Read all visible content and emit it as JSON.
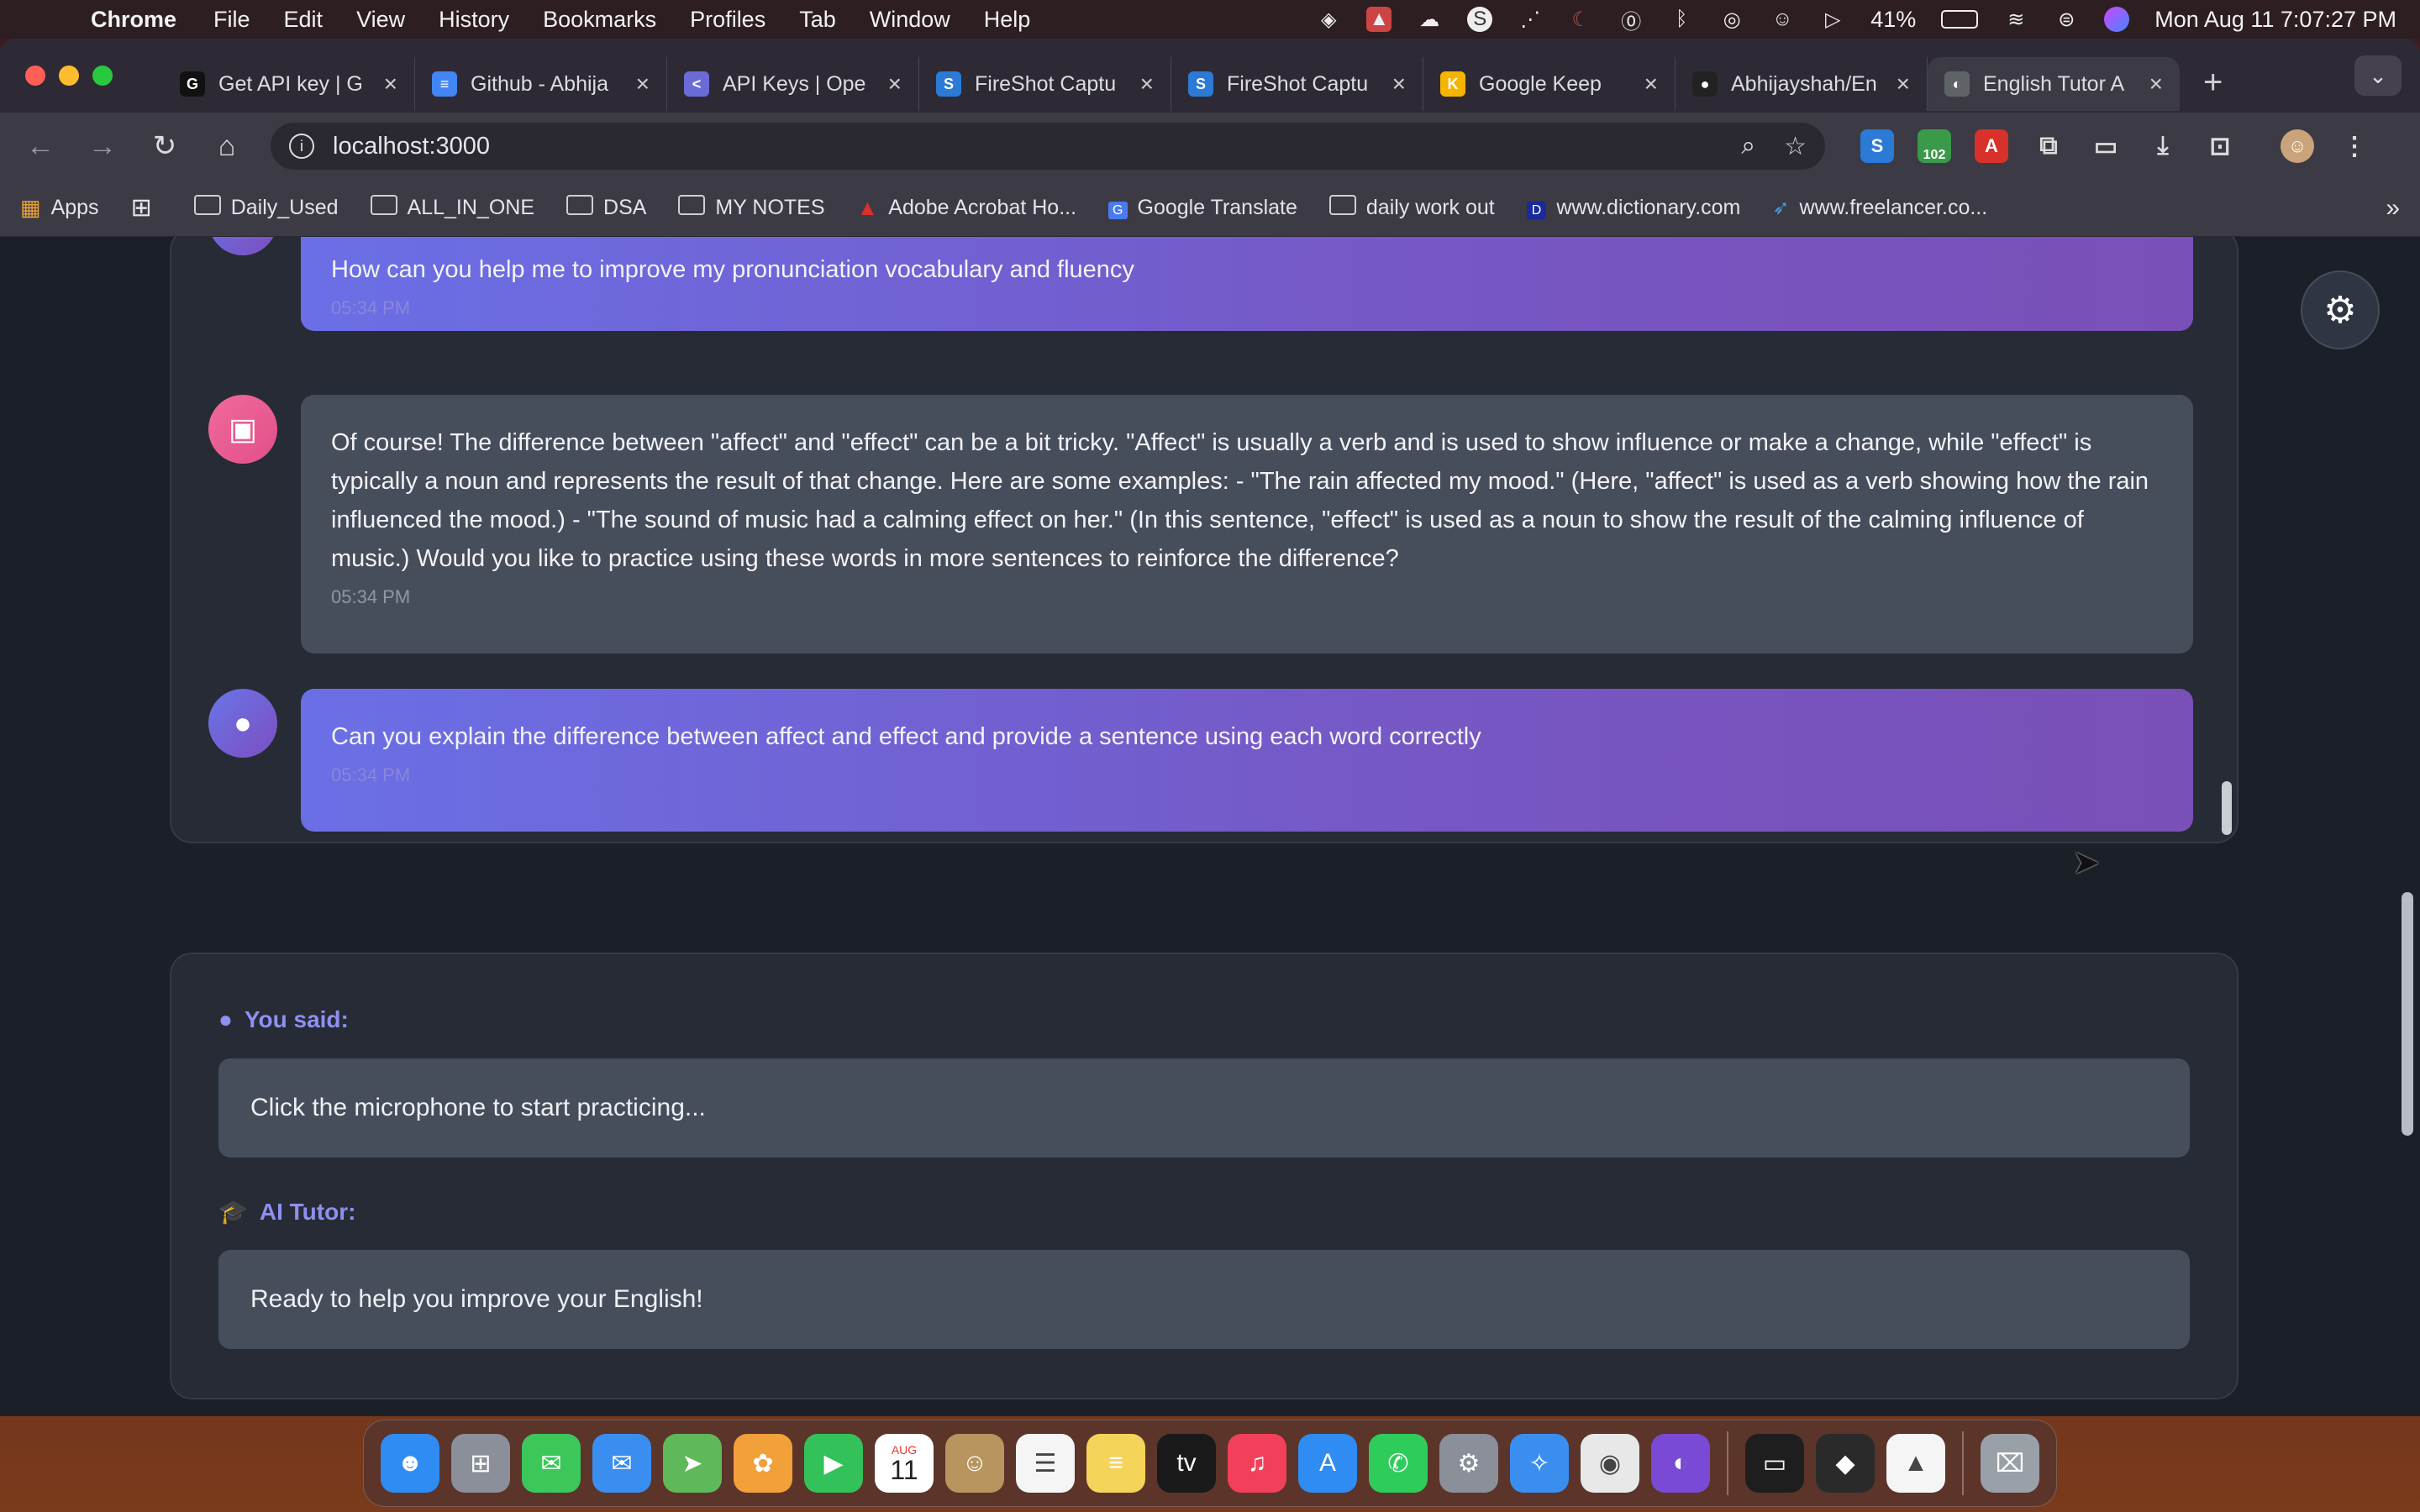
{
  "menubar": {
    "app": "Chrome",
    "items": [
      "File",
      "Edit",
      "View",
      "History",
      "Bookmarks",
      "Profiles",
      "Tab",
      "Window",
      "Help"
    ],
    "battery": "41%",
    "datetime": "Mon Aug 11  7:07:27 PM"
  },
  "tabs": [
    {
      "title": "Get API key | G",
      "color": "#111111",
      "glyph": "G"
    },
    {
      "title": "Github - Abhija",
      "color": "#4285f4",
      "glyph": "≡"
    },
    {
      "title": "API Keys | Ope",
      "color": "#6b6bd8",
      "glyph": "<"
    },
    {
      "title": "FireShot Captu",
      "color": "#2a7ad6",
      "glyph": "S"
    },
    {
      "title": "FireShot Captu",
      "color": "#2a7ad6",
      "glyph": "S"
    },
    {
      "title": "Google Keep",
      "color": "#f6b400",
      "glyph": "K"
    },
    {
      "title": "Abhijayshah/En",
      "color": "#222222",
      "glyph": "●"
    },
    {
      "title": "English Tutor A",
      "color": "#5f6368",
      "glyph": "◐"
    }
  ],
  "address": {
    "url": "localhost:3000"
  },
  "extensions": {
    "badge": "102"
  },
  "bookmarks": [
    {
      "label": "Apps",
      "type": "apps"
    },
    {
      "label": "",
      "type": "grid"
    },
    {
      "label": "Daily_Used",
      "type": "folder"
    },
    {
      "label": "ALL_IN_ONE",
      "type": "folder"
    },
    {
      "label": "DSA",
      "type": "folder"
    },
    {
      "label": "MY NOTES",
      "type": "folder"
    },
    {
      "label": "Adobe Acrobat Ho...",
      "type": "acrobat"
    },
    {
      "label": "Google Translate",
      "type": "translate"
    },
    {
      "label": "daily work out",
      "type": "folder"
    },
    {
      "label": "www.dictionary.com",
      "type": "dictionary"
    },
    {
      "label": "www.freelancer.co...",
      "type": "freelancer"
    }
  ],
  "chat": {
    "messages": [
      {
        "role": "user",
        "text": "How can you help me to improve my pronunciation vocabulary and fluency",
        "time": "05:34 PM"
      },
      {
        "role": "bot",
        "text": "Of course! The difference between \"affect\" and \"effect\" can be a bit tricky. \"Affect\" is usually a verb and is used to show influence or make a change, while \"effect\" is typically a noun and represents the result of that change. Here are some examples: - \"The rain affected my mood.\" (Here, \"affect\" is used as a verb showing how the rain influenced the mood.) - \"The sound of music had a calming effect on her.\" (In this sentence, \"effect\" is used as a noun to show the result of the calming influence of music.) Would you like to practice using these words in more sentences to reinforce the difference?",
        "time": "05:34 PM"
      },
      {
        "role": "user",
        "text": "Can you explain the difference between affect and effect and provide a sentence using each word correctly",
        "time": "05:34 PM"
      }
    ]
  },
  "practice": {
    "you_said_label": "You said:",
    "you_said_text": "Click the microphone to start practicing...",
    "tutor_label": "AI Tutor:",
    "tutor_text": "Ready to help you improve your English!"
  },
  "dock": {
    "apps": [
      {
        "name": "finder-icon",
        "color": "#2f8cf2"
      },
      {
        "name": "launchpad-icon",
        "color": "#8a8f99"
      },
      {
        "name": "messages-icon",
        "color": "#3cc75a"
      },
      {
        "name": "mail-icon",
        "color": "#3a8ef0"
      },
      {
        "name": "maps-icon",
        "color": "#5fb85a"
      },
      {
        "name": "photos-icon",
        "color": "#f2a03a"
      },
      {
        "name": "facetime-icon",
        "color": "#33c25a"
      },
      {
        "name": "calendar-icon",
        "color": "#ffffff"
      },
      {
        "name": "contacts-icon",
        "color": "#b8945e"
      },
      {
        "name": "reminders-icon",
        "color": "#f5f5f5"
      },
      {
        "name": "notes-icon",
        "color": "#f5d45a"
      },
      {
        "name": "tv-icon",
        "color": "#1a1a1a"
      },
      {
        "name": "music-icon",
        "color": "#f2405a"
      },
      {
        "name": "appstore-icon",
        "color": "#2f8cf2"
      },
      {
        "name": "whatsapp-icon",
        "color": "#2ecc5a"
      },
      {
        "name": "settings-icon",
        "color": "#8a8f99"
      },
      {
        "name": "safari-icon",
        "color": "#3a8ef0"
      },
      {
        "name": "chrome-icon",
        "color": "#e8e8e8"
      },
      {
        "name": "firefox-icon",
        "color": "#7a4ad6"
      },
      {
        "name": "terminal-icon",
        "color": "#1e1e1e"
      },
      {
        "name": "cube-icon",
        "color": "#2a2a2a"
      },
      {
        "name": "drive-icon",
        "color": "#f5f5f5"
      },
      {
        "name": "trash-icon",
        "color": "#9aa0a8"
      }
    ],
    "calendar": {
      "month": "AUG",
      "day": "11"
    }
  }
}
